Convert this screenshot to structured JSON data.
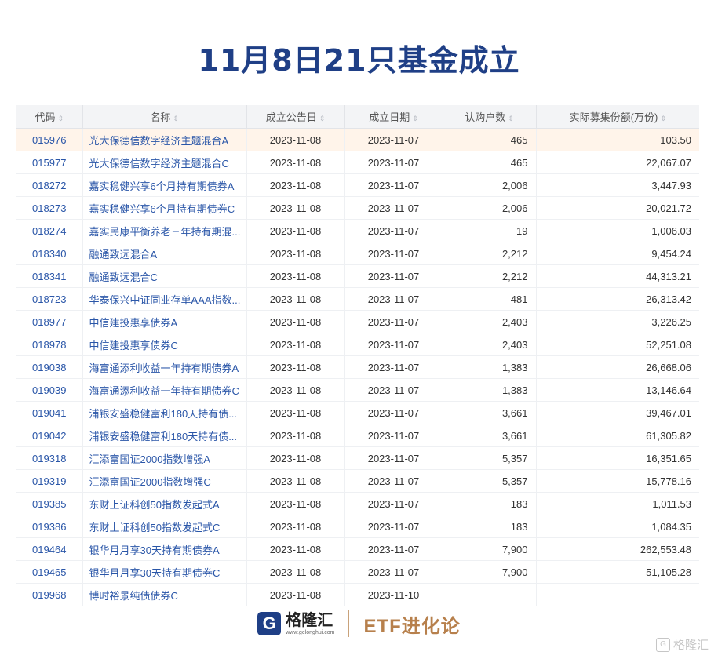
{
  "title": "11月8日21只基金成立",
  "table": {
    "headers": {
      "code": "代码",
      "name": "名称",
      "pub_date": "成立公告日",
      "est_date": "成立日期",
      "subscribers": "认购户数",
      "amount": "实际募集份额(万份)"
    },
    "sort_icon": "⇕",
    "rows": [
      {
        "code": "015976",
        "name": "光大保德信数字经济主题混合A",
        "pub": "2023-11-08",
        "est": "2023-11-07",
        "cnt": "465",
        "amt": "103.50"
      },
      {
        "code": "015977",
        "name": "光大保德信数字经济主题混合C",
        "pub": "2023-11-08",
        "est": "2023-11-07",
        "cnt": "465",
        "amt": "22,067.07"
      },
      {
        "code": "018272",
        "name": "嘉实稳健兴享6个月持有期债券A",
        "pub": "2023-11-08",
        "est": "2023-11-07",
        "cnt": "2,006",
        "amt": "3,447.93"
      },
      {
        "code": "018273",
        "name": "嘉实稳健兴享6个月持有期债券C",
        "pub": "2023-11-08",
        "est": "2023-11-07",
        "cnt": "2,006",
        "amt": "20,021.72"
      },
      {
        "code": "018274",
        "name": "嘉实民康平衡养老三年持有期混...",
        "pub": "2023-11-08",
        "est": "2023-11-07",
        "cnt": "19",
        "amt": "1,006.03"
      },
      {
        "code": "018340",
        "name": "融通致远混合A",
        "pub": "2023-11-08",
        "est": "2023-11-07",
        "cnt": "2,212",
        "amt": "9,454.24"
      },
      {
        "code": "018341",
        "name": "融通致远混合C",
        "pub": "2023-11-08",
        "est": "2023-11-07",
        "cnt": "2,212",
        "amt": "44,313.21"
      },
      {
        "code": "018723",
        "name": "华泰保兴中证同业存单AAA指数...",
        "pub": "2023-11-08",
        "est": "2023-11-07",
        "cnt": "481",
        "amt": "26,313.42"
      },
      {
        "code": "018977",
        "name": "中信建投惠享债券A",
        "pub": "2023-11-08",
        "est": "2023-11-07",
        "cnt": "2,403",
        "amt": "3,226.25"
      },
      {
        "code": "018978",
        "name": "中信建投惠享债券C",
        "pub": "2023-11-08",
        "est": "2023-11-07",
        "cnt": "2,403",
        "amt": "52,251.08"
      },
      {
        "code": "019038",
        "name": "海富通添利收益一年持有期债券A",
        "pub": "2023-11-08",
        "est": "2023-11-07",
        "cnt": "1,383",
        "amt": "26,668.06"
      },
      {
        "code": "019039",
        "name": "海富通添利收益一年持有期债券C",
        "pub": "2023-11-08",
        "est": "2023-11-07",
        "cnt": "1,383",
        "amt": "13,146.64"
      },
      {
        "code": "019041",
        "name": "浦银安盛稳健富利180天持有债...",
        "pub": "2023-11-08",
        "est": "2023-11-07",
        "cnt": "3,661",
        "amt": "39,467.01"
      },
      {
        "code": "019042",
        "name": "浦银安盛稳健富利180天持有债...",
        "pub": "2023-11-08",
        "est": "2023-11-07",
        "cnt": "3,661",
        "amt": "61,305.82"
      },
      {
        "code": "019318",
        "name": "汇添富国证2000指数增强A",
        "pub": "2023-11-08",
        "est": "2023-11-07",
        "cnt": "5,357",
        "amt": "16,351.65"
      },
      {
        "code": "019319",
        "name": "汇添富国证2000指数增强C",
        "pub": "2023-11-08",
        "est": "2023-11-07",
        "cnt": "5,357",
        "amt": "15,778.16"
      },
      {
        "code": "019385",
        "name": "东财上证科创50指数发起式A",
        "pub": "2023-11-08",
        "est": "2023-11-07",
        "cnt": "183",
        "amt": "1,011.53"
      },
      {
        "code": "019386",
        "name": "东财上证科创50指数发起式C",
        "pub": "2023-11-08",
        "est": "2023-11-07",
        "cnt": "183",
        "amt": "1,084.35"
      },
      {
        "code": "019464",
        "name": "银华月月享30天持有期债券A",
        "pub": "2023-11-08",
        "est": "2023-11-07",
        "cnt": "7,900",
        "amt": "262,553.48"
      },
      {
        "code": "019465",
        "name": "银华月月享30天持有期债券C",
        "pub": "2023-11-08",
        "est": "2023-11-07",
        "cnt": "7,900",
        "amt": "51,105.28"
      },
      {
        "code": "019968",
        "name": "博时裕景纯债债券C",
        "pub": "2023-11-08",
        "est": "2023-11-10",
        "cnt": "",
        "amt": ""
      }
    ]
  },
  "footer": {
    "logo_letter": "G",
    "logo_name": "格隆汇",
    "logo_url": "www.gelonghui.com",
    "brand": "ETF进化论"
  },
  "watermark": {
    "icon": "G",
    "text": "格隆汇"
  }
}
